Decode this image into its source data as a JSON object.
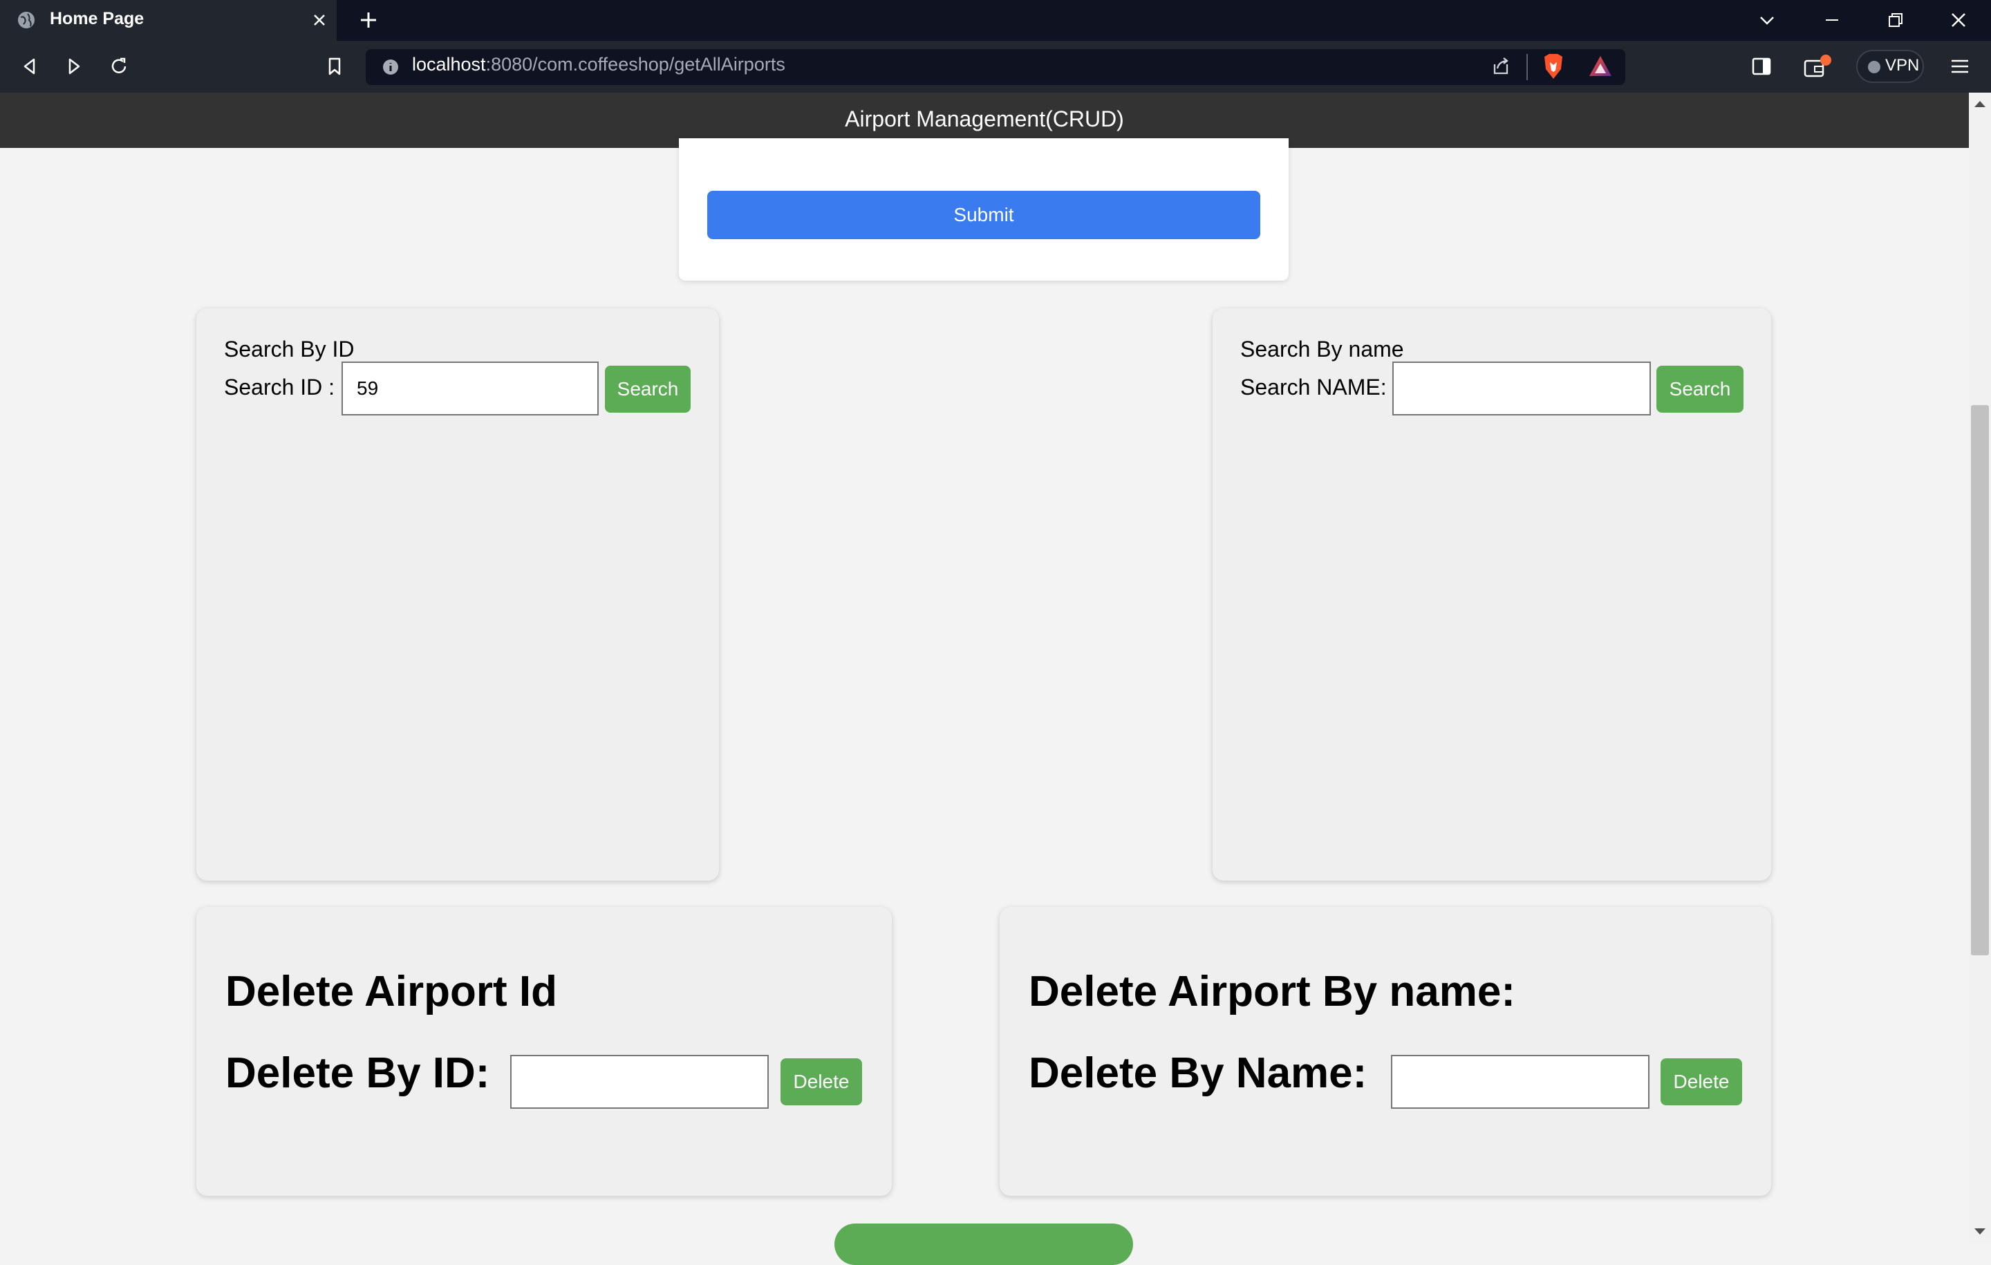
{
  "browser": {
    "tab_title": "Home Page",
    "url_host": "localhost",
    "url_path": ":8080/com.coffeeshop/getAllAirports",
    "vpn_label": "VPN",
    "accent_colors": {
      "brave": "#fb542b",
      "notification": "#fa6b3a"
    }
  },
  "header": {
    "title": "Airport Management(CRUD)"
  },
  "form": {
    "submit_label": "Submit"
  },
  "search_by_id": {
    "heading": "Search By ID",
    "label": "Search ID :",
    "value": "59",
    "button": "Search"
  },
  "search_by_name": {
    "heading": "Search By name",
    "label": "Search NAME:",
    "value": "",
    "button": "Search"
  },
  "delete_by_id": {
    "heading": "Delete Airport Id",
    "label": "Delete By ID:",
    "value": "",
    "button": "Delete"
  },
  "delete_by_name": {
    "heading": "Delete Airport By name:",
    "label": "Delete By Name:",
    "value": "",
    "button": "Delete"
  },
  "colors": {
    "header_bg": "#333333",
    "primary_button": "#3b7bf0",
    "success_button": "#5cac55",
    "card_bg": "#efefef"
  }
}
